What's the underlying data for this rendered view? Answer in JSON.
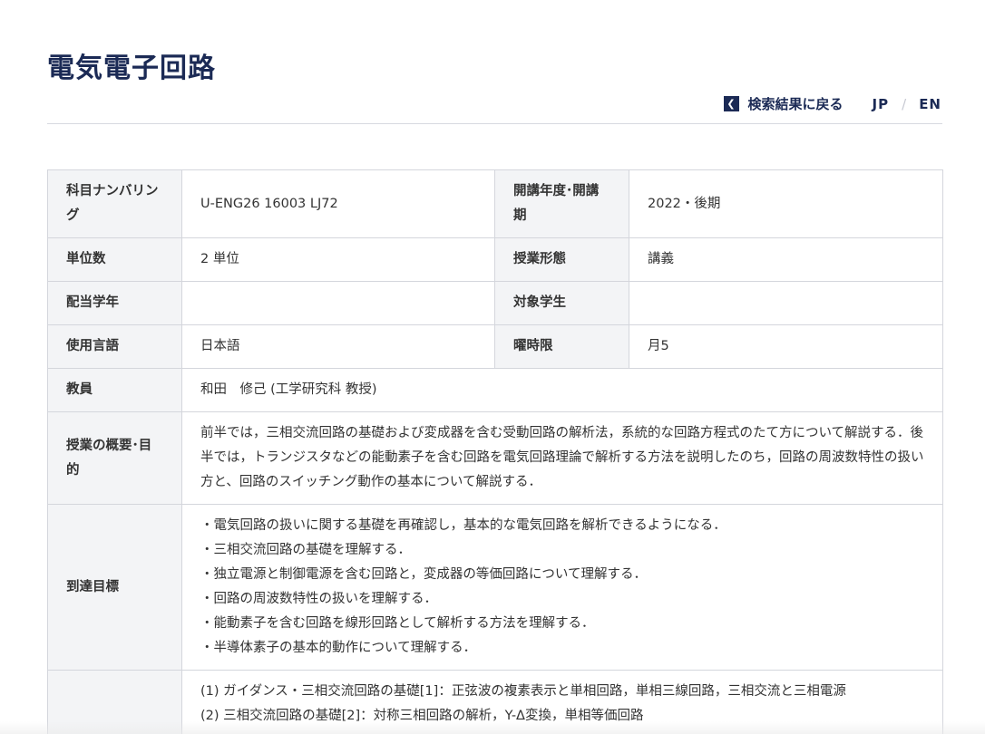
{
  "page_title": "電気電子回路",
  "nav": {
    "back_label": "検索結果に戻る",
    "back_icon": "chevron-left-icon",
    "lang_jp": "JP",
    "lang_sep": "/",
    "lang_en": "EN"
  },
  "course": {
    "numbering_label": "科目ナンバリング",
    "numbering_value": "U-ENG26 16003 LJ72",
    "year_label": "開講年度･開講期",
    "year_value": "2022・後期",
    "credits_label": "単位数",
    "credits_value": "2 単位",
    "format_label": "授業形態",
    "format_value": "講義",
    "grade_label": "配当学年",
    "grade_value": "",
    "target_label": "対象学生",
    "target_value": "",
    "language_label": "使用言語",
    "language_value": "日本語",
    "period_label": "曜時限",
    "period_value": "月5",
    "instructor_label": "教員",
    "instructor_value": "和田　修己 (工学研究科 教授)",
    "overview_label": "授業の概要･目的",
    "overview_value": "前半では，三相交流回路の基礎および変成器を含む受動回路の解析法，系統的な回路方程式のたて方について解説する．後半では，トランジスタなどの能動素子を含む回路を電気回路理論で解析する方法を説明したのち，回路の周波数特性の扱い方と、回路のスイッチング動作の基本について解説する．",
    "goals_label": "到達目標",
    "goals": [
      "・電気回路の扱いに関する基礎を再確認し，基本的な電気回路を解析できるようになる．",
      "・三相交流回路の基礎を理解する．",
      "・独立電源と制御電源を含む回路と，変成器の等価回路について理解する．",
      "・回路の周波数特性の扱いを理解する．",
      "・能動素子を含む回路を線形回路として解析する方法を理解する．",
      "・半導体素子の基本的動作について理解する．"
    ],
    "plan": [
      "(1) ガイダンス・三相交流回路の基礎[1]：正弦波の複素表示と単相回路，単相三線回路，三相交流と三相電源",
      "(2) 三相交流回路の基礎[2]：対称三相回路の解析，Y-Δ変換，単相等価回路"
    ]
  }
}
